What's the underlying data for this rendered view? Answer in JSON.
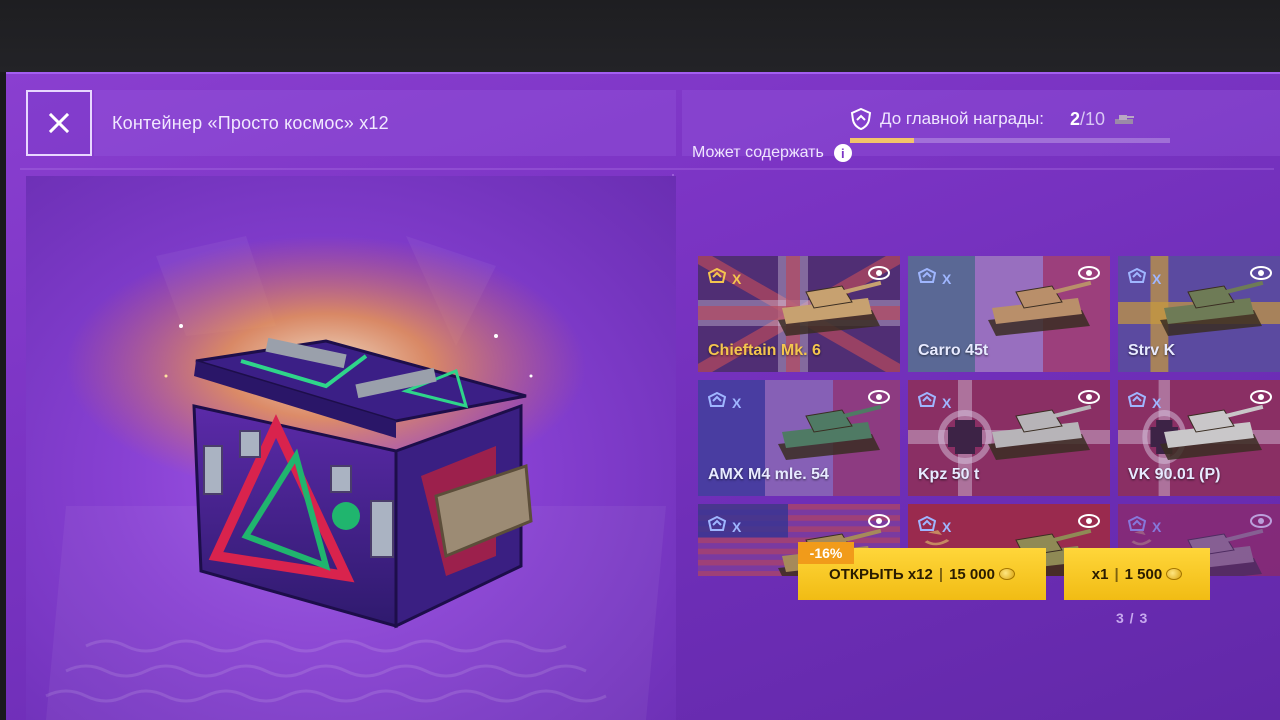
{
  "header": {
    "title": "Контейнер «Просто космос» x12",
    "reward_label": "До главной награды:",
    "reward_current": "2",
    "reward_total": "/10",
    "reward_progress": 0.2
  },
  "contents": {
    "title": "Может содержать",
    "cards": [
      {
        "name": "Chieftain Mk. 6",
        "tier": "X",
        "style": "gold",
        "nation": "uk"
      },
      {
        "name": "Carro 45t",
        "tier": "X",
        "style": "normal",
        "nation": "italy"
      },
      {
        "name": "Strv K",
        "tier": "X",
        "style": "normal",
        "nation": "sweden"
      },
      {
        "name": "AMX M4 mle. 54",
        "tier": "X",
        "style": "normal",
        "nation": "france"
      },
      {
        "name": "Kpz 50 t",
        "tier": "X",
        "style": "normal",
        "nation": "germany"
      },
      {
        "name": "VK 90.01 (P)",
        "tier": "X",
        "style": "normal",
        "nation": "germany"
      },
      {
        "name": "",
        "tier": "X",
        "style": "normal",
        "nation": "usa"
      },
      {
        "name": "",
        "tier": "X",
        "style": "normal",
        "nation": "ussr"
      },
      {
        "name": "",
        "tier": "X",
        "style": "normal",
        "nation": "ussr"
      }
    ]
  },
  "buttons": {
    "discount": "-16%",
    "open_label": "ОТКРЫТЬ x12",
    "open_price": "15 000",
    "single_label": "x1",
    "single_price": "1 500",
    "page_indicator": "3 / 3"
  },
  "colors": {
    "accent_gold": "#f4c54e",
    "button_yellow": "#ffd63a",
    "discount_orange": "#f19b1a",
    "panel_purple": "#7b34c4"
  }
}
